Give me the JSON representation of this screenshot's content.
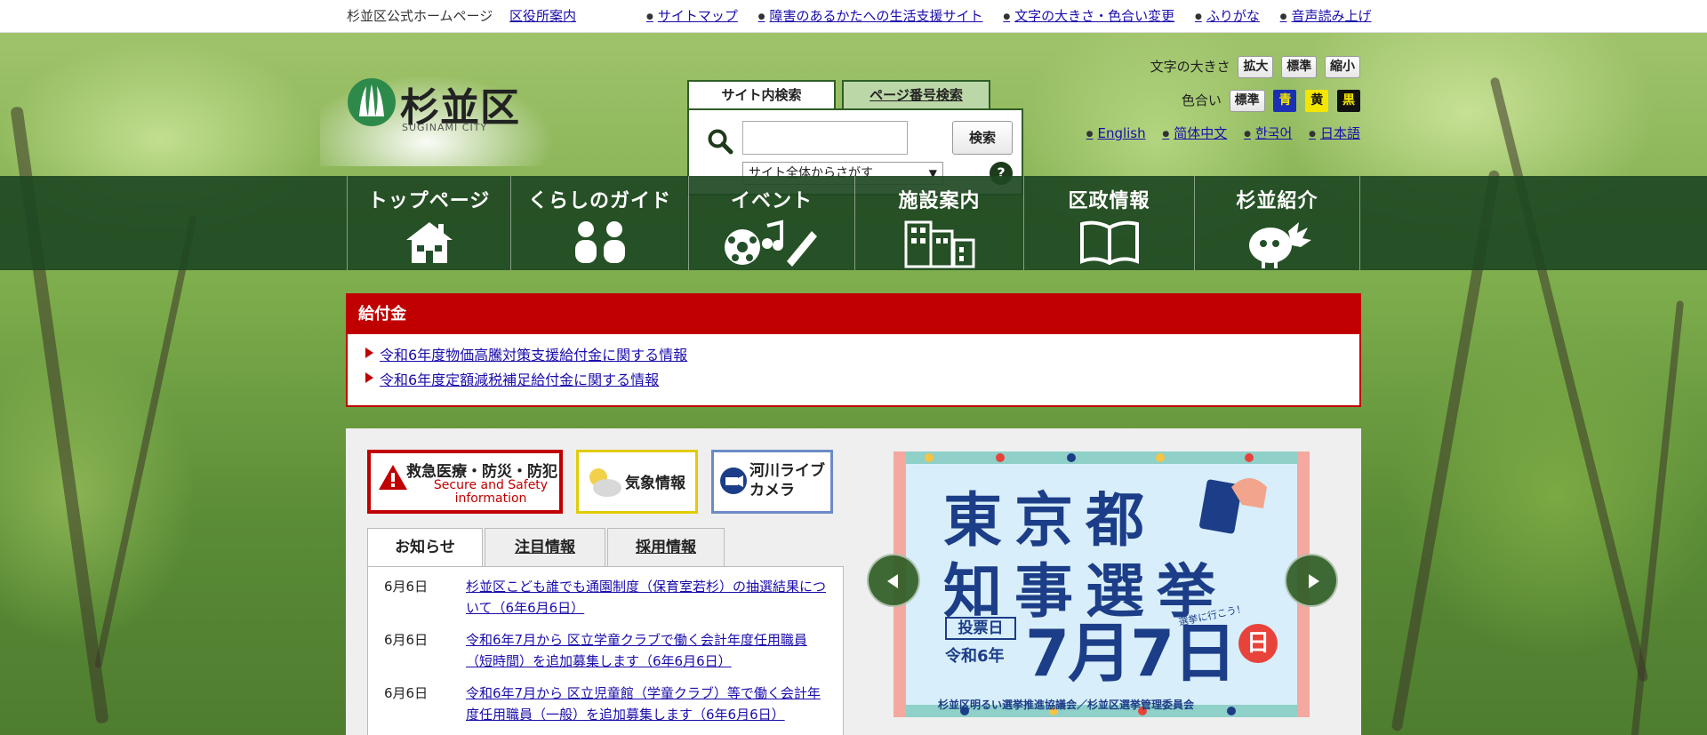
{
  "utility": {
    "site_name": "杉並区公式ホームページ",
    "office_link": "区役所案内",
    "links": [
      "サイトマップ",
      "障害のあるかたへの生活支援サイト",
      "文字の大きさ・色合い変更",
      "ふりがな",
      "音声読み上げ"
    ]
  },
  "logo": {
    "name": "杉並区",
    "sub": "SUGINAMI CITY"
  },
  "search": {
    "tab_site": "サイト内検索",
    "tab_page": "ページ番号検索",
    "input_value": "",
    "button": "検索",
    "select_value": "サイト全体からさがす",
    "help": "?"
  },
  "accessibility": {
    "text_size_label": "文字の大きさ",
    "text_size_buttons": [
      "拡大",
      "標準",
      "縮小"
    ],
    "color_label": "色合い",
    "color_buttons": [
      "標準",
      "青",
      "黄",
      "黒"
    ],
    "colors": {
      "standard": "#f2f2f2",
      "blue": "#1a2fb3",
      "yellow": "#f5e600",
      "black": "#111111"
    }
  },
  "languages": [
    "English",
    "简体中文",
    "한국어",
    "日本語"
  ],
  "nav": [
    {
      "label": "トップページ",
      "icon": "house-icon"
    },
    {
      "label": "くらしのガイド",
      "icon": "people-icon"
    },
    {
      "label": "イベント",
      "icon": "event-icon"
    },
    {
      "label": "施設案内",
      "icon": "building-icon"
    },
    {
      "label": "区政情報",
      "icon": "book-icon"
    },
    {
      "label": "杉並紹介",
      "icon": "mascot-icon"
    }
  ],
  "notice": {
    "title": "給付金",
    "items": [
      "令和6年度物価高騰対策支援給付金に関する情報",
      "令和6年度定額減税補足給付金に関する情報"
    ]
  },
  "banners": {
    "emergency_title": "救急医療・防災・防犯",
    "emergency_en": "Secure and Safety information",
    "weather": "気象情報",
    "river": "河川ライブカメラ"
  },
  "news": {
    "tabs": [
      "お知らせ",
      "注目情報",
      "採用情報"
    ],
    "items": [
      {
        "date": "6月6日",
        "text": "杉並区こども誰でも通園制度（保育室若杉）の抽選結果について（6年6月6日）"
      },
      {
        "date": "6月6日",
        "text": "令和6年7月から 区立学童クラブで働く会計年度任用職員（短時間）を追加募集します（6年6月6日）"
      },
      {
        "date": "6月6日",
        "text": "令和6年7月から 区立児童館（学童クラブ）等で働く会計年度任用職員（一般）を追加募集します（6年6月6日）"
      }
    ]
  },
  "slide": {
    "line1": "東京都",
    "line2": "知事選挙",
    "vote_label": "投票日",
    "year": "令和6年",
    "date": "7月7日",
    "weekday": "日",
    "slogan": "選挙に行こう！",
    "org": "杉並区明るい選挙推進協議会／杉並区選挙管理委員会"
  }
}
